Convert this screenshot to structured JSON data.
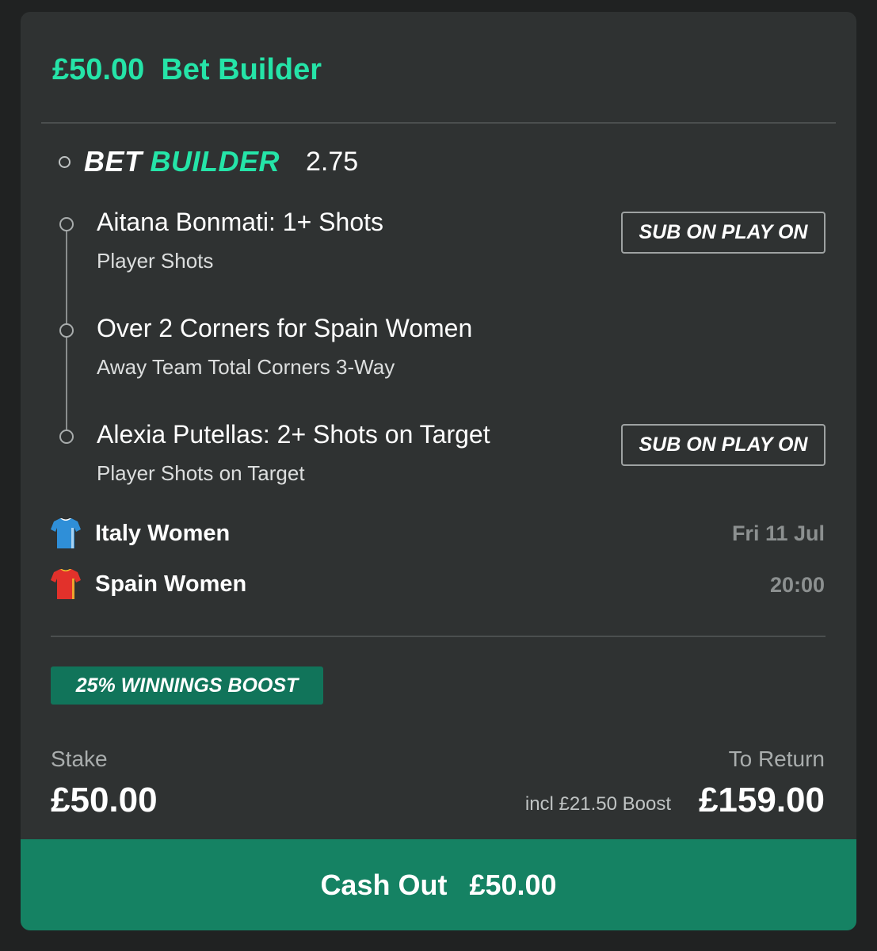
{
  "header": {
    "stake_display": "£50.00",
    "bet_type": "Bet Builder"
  },
  "builder": {
    "brand_word1": "BET",
    "brand_word2": "BUILDER",
    "odds": "2.75"
  },
  "selections": [
    {
      "title": "Aitana Bonmati: 1+ Shots",
      "market": "Player Shots",
      "badge": "SUB ON PLAY ON"
    },
    {
      "title": "Over 2 Corners for Spain Women",
      "market": "Away Team Total Corners 3-Way"
    },
    {
      "title": "Alexia Putellas: 2+ Shots on Target",
      "market": "Player Shots on Target",
      "badge": "SUB ON PLAY ON"
    }
  ],
  "event": {
    "home": "Italy Women",
    "away": "Spain Women",
    "date": "Fri 11 Jul",
    "time": "20:00"
  },
  "boost_label": "25% WINNINGS BOOST",
  "stake": {
    "label": "Stake",
    "value": "£50.00"
  },
  "returns": {
    "label": "To Return",
    "boost_note": "incl £21.50 Boost",
    "value": "£159.00"
  },
  "cashout": {
    "label": "Cash Out",
    "amount": "£50.00"
  },
  "colors": {
    "accent_green": "#25e4a8",
    "card_bg": "#2f3232",
    "boost_bg": "#11745a",
    "cashout_bg": "#158263",
    "italy_shirt": "#2f8fd8",
    "spain_shirt": "#e2312b"
  },
  "icons": [
    "timeline-ring-icon",
    "italy-shirt-icon",
    "spain-shirt-icon"
  ]
}
